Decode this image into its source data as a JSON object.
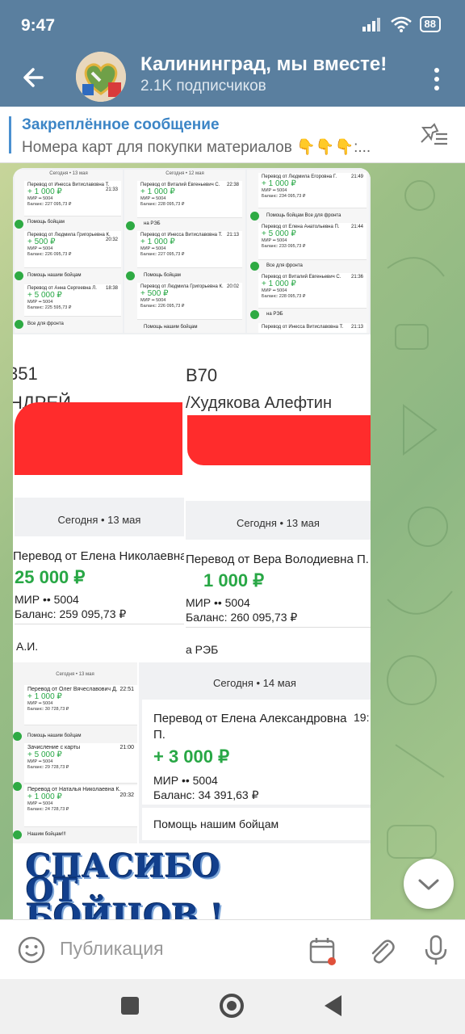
{
  "status": {
    "time": "9:47",
    "battery": "88"
  },
  "header": {
    "title": "Калининград, мы вместе!",
    "subscribers": "2.1K подписчиков"
  },
  "pinned": {
    "title": "Закреплённое сообщение",
    "text": "Номера карт для покупки материалов 👇👇👇:..."
  },
  "photo1": {
    "col1": {
      "date": "Сегодня • 13 мая",
      "items": [
        {
          "from": "Перевод от Инесса Витиславовна Т.",
          "time": "21:33",
          "amount": "+ 1 000 ₽",
          "card": "МИР •• 5004",
          "balance": "Баланс: 227 095,73 ₽",
          "note": "Помощь бойцам"
        },
        {
          "from": "Перевод от Людмила Григорьевна К.",
          "time": "20:32",
          "amount": "+ 500 ₽",
          "card": "МИР •• 5004",
          "balance": "Баланс: 226 095,73 ₽",
          "note": "Помощь нашим бойцам"
        },
        {
          "from": "Перевод от Анна Сергеевна Л.",
          "time": "18:38",
          "amount": "+ 5 000 ₽",
          "card": "МИР •• 5004",
          "balance": "Баланс: 225 595,73 ₽",
          "note": "Все для фронта"
        }
      ]
    },
    "col2": {
      "date": "Сегодня • 12 мая",
      "items": [
        {
          "from": "Перевод от Виталий Евгеньевич С.",
          "time": "22:38",
          "amount": "+ 1 000 ₽",
          "card": "МИР •• 5004",
          "balance": "Баланс: 228 095,73 ₽",
          "note": "на РЭБ"
        },
        {
          "from": "Перевод от Инесса Витиславовна Т.",
          "time": "21:13",
          "amount": "+ 1 000 ₽",
          "card": "МИР •• 5004",
          "balance": "Баланс: 227 095,73 ₽",
          "note": "Помощь бойцам"
        },
        {
          "from": "Перевод от Людмила Григорьевна К.",
          "time": "20:02",
          "amount": "+ 500 ₽",
          "card": "МИР •• 5004",
          "balance": "Баланс: 226 095,73 ₽",
          "note": "Помощь нашим бойцам"
        }
      ]
    },
    "col3": {
      "items": [
        {
          "from": "Перевод от Людмила Егоровна Г.",
          "time": "21:49",
          "amount": "+ 1 000 ₽",
          "card": "МИР •• 5004",
          "balance": "Баланс: 234 095,73 ₽",
          "note": "Помощь бойцам Все для фронта"
        },
        {
          "from": "Перевод от Елена Анатольевна П.",
          "time": "21:44",
          "amount": "+ 5 000 ₽",
          "card": "МИР •• 5004",
          "balance": "Баланс: 233 095,73 ₽",
          "note": "Все для фронта"
        },
        {
          "from": "Перевод от Виталий Евгеньевич С.",
          "time": "21:36",
          "amount": "+ 1 000 ₽",
          "card": "МИР •• 5004",
          "balance": "Баланс: 228 095,73 ₽",
          "note": "на РЭБ"
        },
        {
          "from": "Перевод от Инесса Витиславовна Т.",
          "time": "21:13",
          "amount": "",
          "card": "",
          "balance": "",
          "note": ""
        }
      ]
    }
  },
  "photo2": {
    "left": {
      "card_tail": "351",
      "name_part": "НДРЕЙ",
      "date": "Сегодня • 13 мая",
      "from": "Перевод от Елена Николаевна А.",
      "amount": "25 000 ₽",
      "card": "МИР •• 5004",
      "balance": "Баланс: 259 095,73 ₽",
      "note": "А.И."
    },
    "right": {
      "card_tail": "В70",
      "name_part": "/Худякова Алефтин",
      "date": "Сегодня • 13 мая",
      "from": "Перевод от Вера Володиевна П.",
      "amount": "1 000 ₽",
      "card": "МИР •• 5004",
      "balance": "Баланс: 260 095,73 ₽",
      "note": "а РЭБ"
    }
  },
  "photo3": {
    "left": {
      "date": "Сегодня • 13 мая",
      "items": [
        {
          "from": "Перевод от Олег Вячеславович Д.",
          "time": "22:51",
          "amount": "+ 1 000 ₽",
          "card": "МИР •• 5004",
          "balance": "Баланс: 30 728,73 ₽",
          "note": "Помощь нашим бойцам"
        },
        {
          "from": "Зачисление с карты",
          "time": "21:00",
          "amount": "+ 5 000 ₽",
          "card": "МИР •• 5004",
          "balance": "Баланс: 29 728,73 ₽",
          "note": ""
        },
        {
          "from": "Перевод от Наталья Николаевна К.",
          "time": "20:32",
          "amount": "+ 1 000 ₽",
          "card": "МИР •• 5004",
          "balance": "Баланс: 24 728,73 ₽",
          "note": "Нашим бойцам!!!"
        }
      ]
    },
    "right": {
      "date": "Сегодня • 14 мая",
      "from": "Перевод от Елена Александровна П.",
      "time": "19:",
      "amount": "+ 3 000 ₽",
      "card": "МИР •• 5004",
      "balance": "Баланс: 34 391,63 ₽",
      "note": "Помощь нашим бойцам"
    }
  },
  "thanks": {
    "line1": "СПАСИБО",
    "line2": "ОТ",
    "line3": "БОЙЦОВ !"
  },
  "composer": {
    "placeholder": "Публикация"
  },
  "colors": {
    "header": "#5a7f9f",
    "accent": "#3c85c6",
    "income": "#28a745",
    "redaction": "#ff2c2c"
  }
}
